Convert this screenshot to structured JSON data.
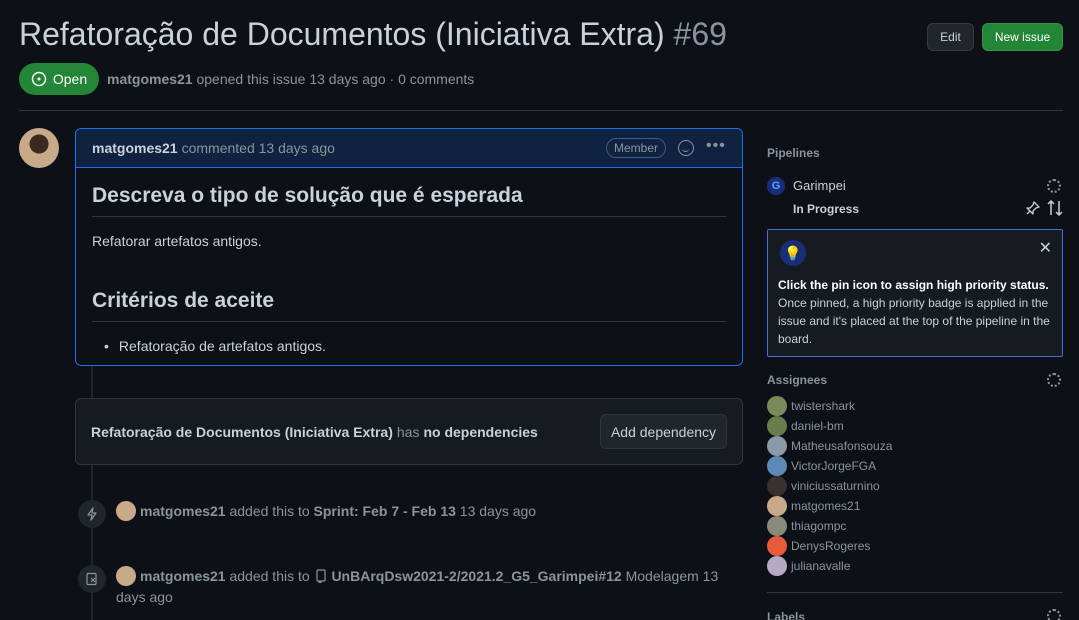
{
  "issue": {
    "title": "Refatoração de Documentos (Iniciativa Extra)",
    "number": "#69",
    "status": "Open",
    "author": "matgomes21",
    "meta_text": "opened this issue 13 days ago · 0 comments"
  },
  "header_buttons": {
    "edit": "Edit",
    "new_issue": "New issue"
  },
  "comment": {
    "author": "matgomes21",
    "timestamp": "commented 13 days ago",
    "role_badge": "Member",
    "heading1": "Descreva o tipo de solução que é esperada",
    "paragraph": "Refatorar artefatos antigos.",
    "heading2": "Critérios de aceite",
    "list_item": "Refatoração de artefatos antigos."
  },
  "dependency": {
    "issue_title": "Refatoração de Documentos (Iniciativa Extra)",
    "middle_text": "has",
    "status_text": "no dependencies",
    "button": "Add dependency"
  },
  "events": [
    {
      "author": "matgomes21",
      "text": "added this to",
      "target": "Sprint: Feb 7 - Feb 13",
      "time": "13 days ago"
    },
    {
      "author": "matgomes21",
      "text": "added this to",
      "target": "UnBArqDsw2021-2/2021.2_G5_Garimpei#12",
      "extra": "Modelagem",
      "time": "13 days ago"
    }
  ],
  "sidebar": {
    "pipelines_label": "Pipelines",
    "workspace_initial": "G",
    "workspace_name": "Garimpei",
    "pipeline_status": "In Progress",
    "tip_title": "Click the pin icon to assign high priority status.",
    "tip_body": "Once pinned, a high priority badge is applied in the issue and it's placed at the top of the pipeline in the board.",
    "assignees_label": "Assignees",
    "assignees": [
      {
        "name": "twistershark",
        "color": "#7a8a5a"
      },
      {
        "name": "daniel-bm",
        "color": "#6a7c4a"
      },
      {
        "name": "Matheusafonsouza",
        "color": "#8a9aa8"
      },
      {
        "name": "VictorJorgeFGA",
        "color": "#5a8ab8"
      },
      {
        "name": "viniciussaturnino",
        "color": "#3a3030"
      },
      {
        "name": "matgomes21",
        "color": "#c8a98a"
      },
      {
        "name": "thiagompc",
        "color": "#8a8a7a"
      },
      {
        "name": "DenysRogeres",
        "color": "#e85a3a"
      },
      {
        "name": "julianavalle",
        "color": "#b8a8c8"
      }
    ],
    "labels_label": "Labels"
  },
  "colors": {
    "open_green": "#238636",
    "accent_blue": "#1f6feb",
    "bg": "#0d1117"
  }
}
